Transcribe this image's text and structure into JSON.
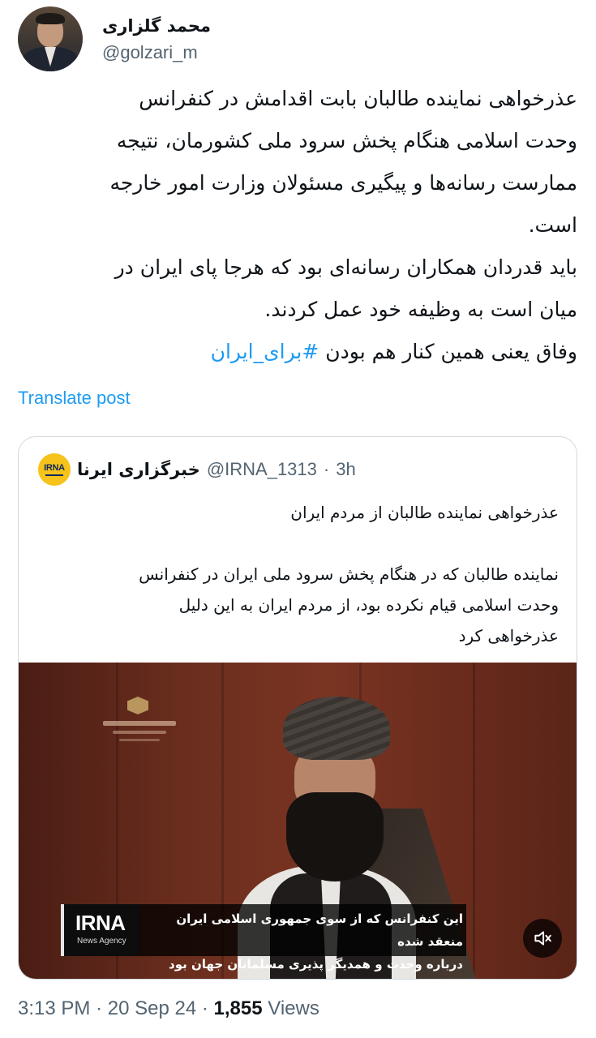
{
  "author": {
    "name": "محمد گلزاری",
    "handle": "@golzari_m"
  },
  "tweet": {
    "lines": [
      "عذرخواهی نماینده طالبان بابت اقدامش در کنفرانس",
      "وحدت اسلامی هنگام پخش سرود ملی کشورمان، نتیجه",
      "ممارست رسانه‌ها و پیگیری مسئولان وزارت امور خارجه",
      "است.",
      "باید قدردان همکاران رسانه‌ای بود که هرجا پای ایران در",
      "میان است به وظیفه خود عمل کردند."
    ],
    "last_line_text": "وفاق یعنی همین کنار هم بودن",
    "hashtag": "#برای_ایران",
    "translate_label": "Translate post"
  },
  "quote": {
    "logo_text": "IRNA",
    "name": "خبرگزاری ایرنا",
    "handle": "@IRNA_1313",
    "separator": "·",
    "time": "3h",
    "title": "عذرخواهی نماینده طالبان از مردم ایران",
    "body_lines": [
      "نماینده طالبان که در هنگام پخش سرود ملی ایران در کنفرانس",
      "وحدت اسلامی قیام نکرده بود، از مردم ایران به این دلیل",
      "عذرخواهی کرد"
    ],
    "video": {
      "ticker_logo": "IRNA",
      "ticker_sub": "News Agency",
      "ticker_line1": "این کنفرانس که از سوی جمهوری اسلامی ایران منعقد شده",
      "ticker_line2": "درباره وحدت و همدیگر پذیری مسلمانان جهان بود",
      "mute_icon": "mute-icon"
    }
  },
  "footer": {
    "time": "3:13 PM",
    "sep1": "·",
    "date": "20 Sep 24",
    "sep2": "·",
    "views_count": "1,855",
    "views_label": "Views"
  }
}
